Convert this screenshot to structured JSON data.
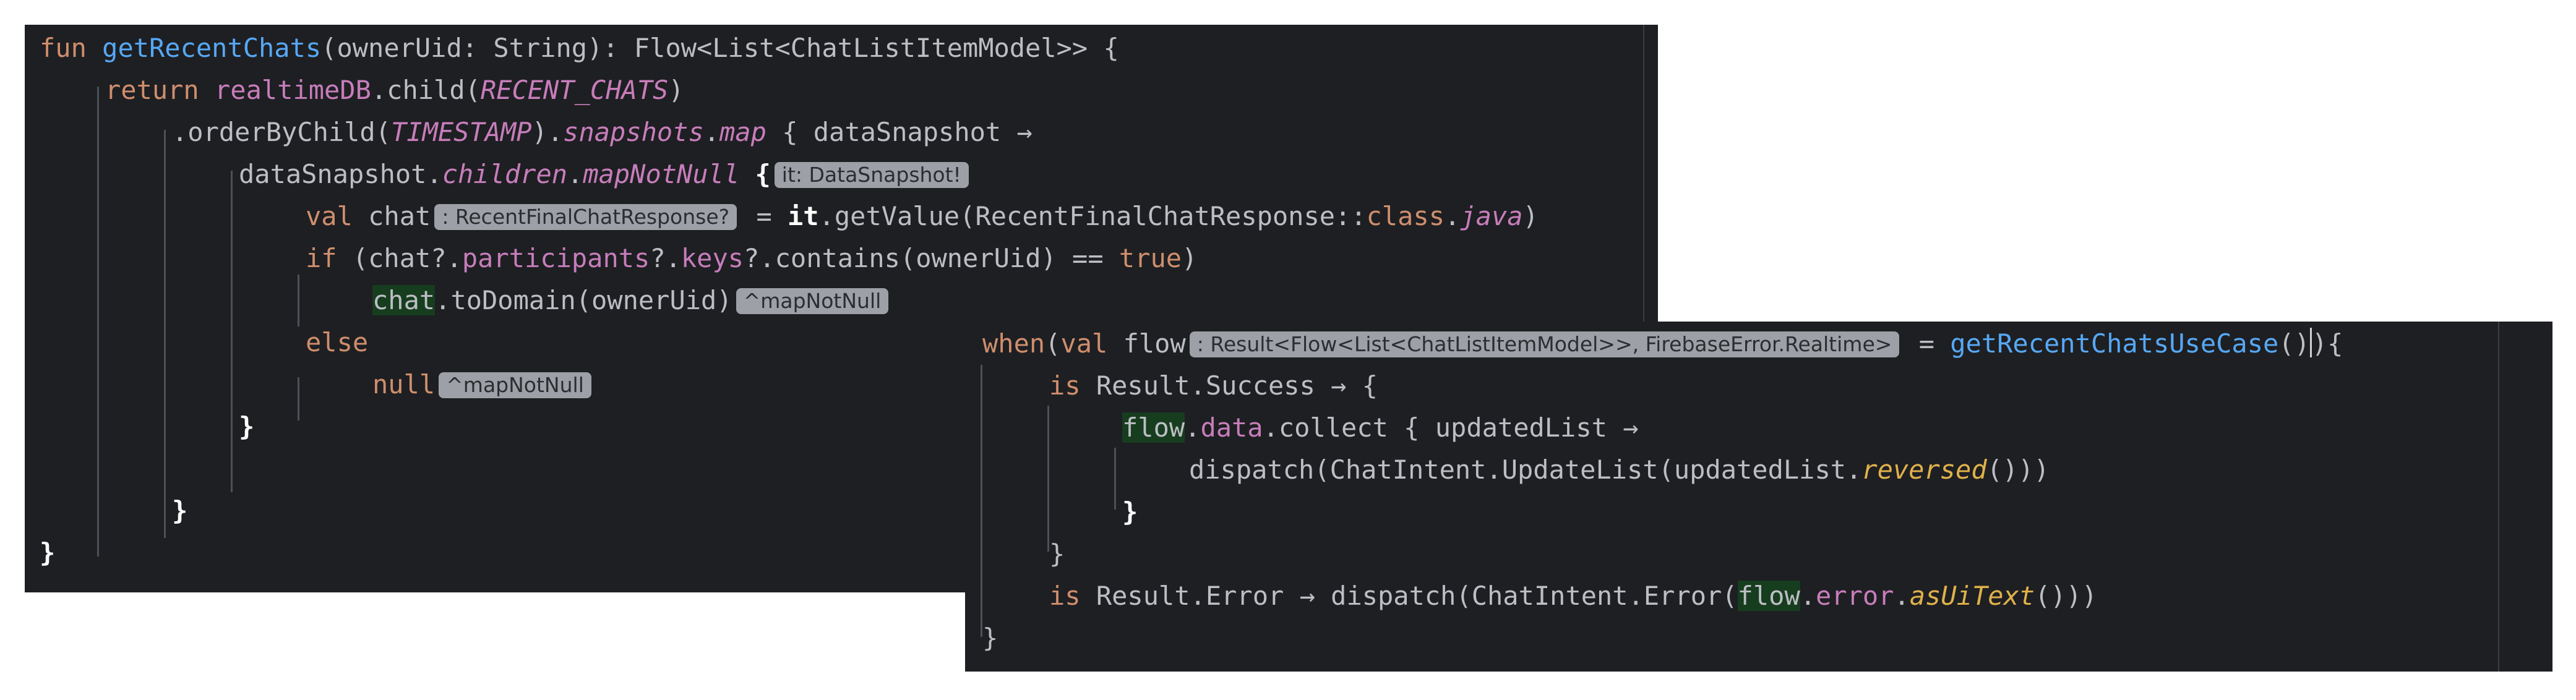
{
  "panel_a": {
    "line1": {
      "kw": "fun ",
      "fn": "getRecentChats",
      "rest": "(ownerUid: String): Flow<List<ChatListItemModel>> {"
    },
    "line2": {
      "kw": "return ",
      "obj": "realtimeDB",
      "mid": ".child(",
      "const": "RECENT_CHATS",
      "end": ")"
    },
    "line3": {
      "pre": ".orderByChild(",
      "const": "TIMESTAMP",
      "mid": ").",
      "p1": "snapshots",
      "dot": ".",
      "p2": "map",
      "end": " { dataSnapshot →"
    },
    "line4": {
      "pre": "dataSnapshot.",
      "p1": "children",
      "dot": ".",
      "p2": "mapNotNull",
      "brace": " {",
      "hint": "it: DataSnapshot!"
    },
    "line5": {
      "kw": "val ",
      "var": "chat",
      "hint": ": RecentFinalChatResponse?",
      "eq": " = ",
      "it": "it",
      "mid": ".getValue(RecentFinalChatResponse::",
      "cls": "class",
      "dot": ".",
      "java": "java",
      "end": ")"
    },
    "line6": {
      "kw": "if ",
      "pre": "(chat",
      "q1": "?.",
      "p1": "participants",
      "q2": "?.",
      "p2": "keys",
      "q3": "?.",
      "mid": "contains(ownerUid) == ",
      "tr": "true",
      "end": ")"
    },
    "line7": {
      "var": "chat",
      "rest": ".toDomain(ownerUid)",
      "hint": "^mapNotNull"
    },
    "line8": {
      "kw": "else"
    },
    "line9": {
      "kw": "null",
      "hint": "^mapNotNull"
    },
    "line10": {
      "brace": "}"
    },
    "line12": {
      "brace": "}"
    },
    "line13": {
      "brace": "}"
    }
  },
  "panel_b": {
    "line1": {
      "kw": "when",
      "pre": "(",
      "kw2": "val ",
      "var": "flow",
      "hint": ": Result<Flow<List<ChatListItemModel>>, FirebaseError.Realtime>",
      "eq": " = ",
      "fn": "getRecentChatsUseCase",
      "end": "()",
      "end2": "){"
    },
    "line2": {
      "kw": "is ",
      "rest": "Result.Success → {"
    },
    "line3": {
      "var": "flow",
      "dot": ".",
      "p1": "data",
      "rest": ".collect { updatedList →"
    },
    "line4": {
      "pre": "dispatch(ChatIntent.UpdateList(updatedList.",
      "ext": "reversed",
      "end": "()))"
    },
    "line5": {
      "brace": "}"
    },
    "line6": {
      "brace": "}"
    },
    "line7": {
      "kw": "is ",
      "pre": "Result.Error → dispatch(ChatIntent.Error(",
      "var": "flow",
      "dot": ".",
      "p1": "error",
      "dot2": ".",
      "ext": "asUiText",
      "end": "()))"
    },
    "line8": {
      "brace": "}"
    }
  },
  "colors": {
    "background": "#1e1f22",
    "keyword": "#cf8e6d",
    "function": "#56a8f5",
    "property": "#c77dbb",
    "extension": "#e0b14a",
    "text": "#bcbec4",
    "highlight": "#173d1f",
    "hint_bg": "#9da0a6"
  }
}
